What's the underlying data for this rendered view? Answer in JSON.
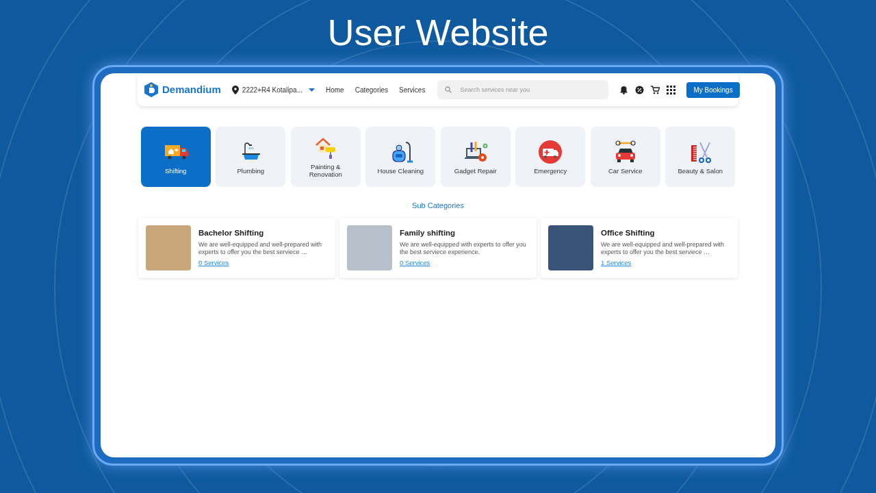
{
  "banner_title": "User Website",
  "navbar": {
    "logo": "Demandium",
    "location": "2222+R4 Kotalipa...",
    "links": [
      "Home",
      "Categories",
      "Services"
    ],
    "search": {
      "placeholder": "Search services near you"
    },
    "bookings_button": "My Bookings"
  },
  "categories": [
    {
      "label": "Shifting",
      "selected": true
    },
    {
      "label": "Plumbing",
      "selected": false
    },
    {
      "label": "Painting & Renovation",
      "selected": false
    },
    {
      "label": "House Cleaning",
      "selected": false
    },
    {
      "label": "Gadget Repair",
      "selected": false
    },
    {
      "label": "Emergency",
      "selected": false
    },
    {
      "label": "Car Service",
      "selected": false
    },
    {
      "label": "Beauty & Salon",
      "selected": false
    }
  ],
  "sub_categories_heading": "Sub Categories",
  "sub_categories": [
    {
      "title": "Bachelor Shifting",
      "description": "We are well-equipped and well-prepared with experts to offer you the best serviece …",
      "services": "0 Services"
    },
    {
      "title": "Family shifting",
      "description": "We are well-equipped with experts to offer you the best serviece experience.",
      "services": "0 Services"
    },
    {
      "title": "Office Shifting",
      "description": "We are well-equipped and well-prepared with experts to offer you the best serviece …",
      "services": "1 Services"
    }
  ]
}
